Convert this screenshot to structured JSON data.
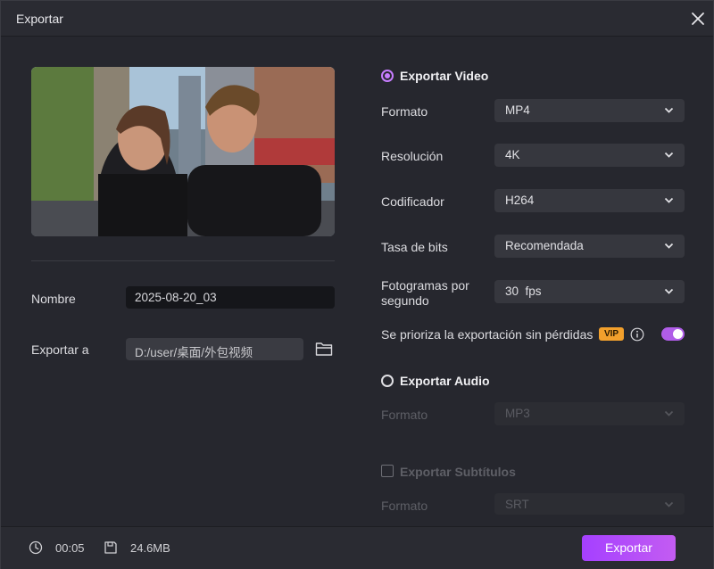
{
  "window": {
    "title": "Exportar"
  },
  "left": {
    "name_label": "Nombre",
    "name_value": "2025-08-20_03",
    "export_to_label": "Exportar a",
    "export_path": "D:/user/桌面/外包视频"
  },
  "video": {
    "title": "Exportar Video",
    "format": {
      "label": "Formato",
      "value": "MP4"
    },
    "resolution": {
      "label": "Resolución",
      "value": "4K"
    },
    "encoder": {
      "label": "Codificador",
      "value": "H264"
    },
    "bitrate": {
      "label": "Tasa de bits",
      "value": "Recomendada"
    },
    "fps": {
      "label_line1": "Fotogramas por",
      "label_line2": "segundo",
      "value": "30  fps"
    },
    "lossless": {
      "label": "Se prioriza la exportación sin pérdidas",
      "badge": "VIP",
      "enabled": true
    }
  },
  "audio": {
    "title": "Exportar Audio",
    "format": {
      "label": "Formato",
      "value": "MP3"
    }
  },
  "subtitles": {
    "title": "Exportar Subtítulos",
    "format": {
      "label": "Formato",
      "value": "SRT"
    }
  },
  "footer": {
    "duration": "00:05",
    "size": "24.6MB",
    "export_button": "Exportar"
  },
  "colors": {
    "accent": "#b05de8",
    "vip": "#f2a02c"
  }
}
